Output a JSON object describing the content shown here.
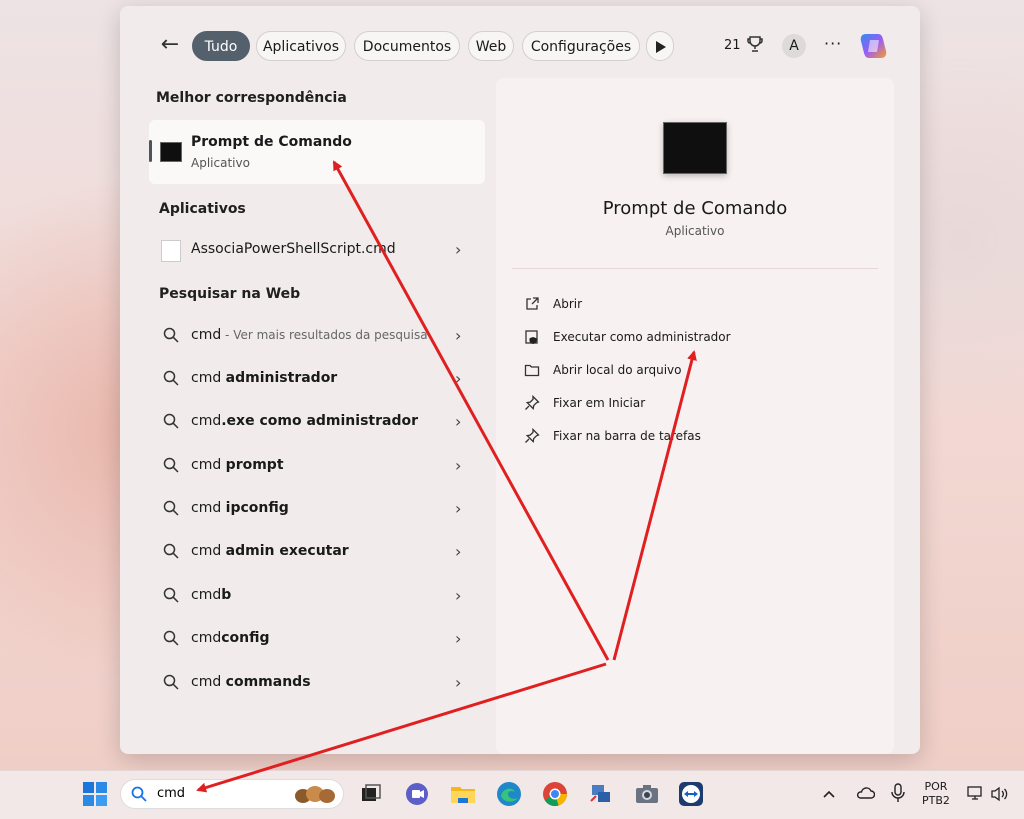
{
  "search_panel": {
    "tabs": [
      "Tudo",
      "Aplicativos",
      "Documentos",
      "Web",
      "Configurações"
    ],
    "active_tab": "Tudo",
    "points": "21",
    "avatar_initial": "A",
    "more_label": "···"
  },
  "best_match": {
    "heading": "Melhor correspondência",
    "name": "Prompt de Comando",
    "type": "Aplicativo"
  },
  "apps": {
    "heading": "Aplicativos",
    "items": [
      {
        "name": "AssociaPowerShellScript.cmd"
      }
    ]
  },
  "web": {
    "heading": "Pesquisar na Web",
    "first": {
      "query": "cmd",
      "hint": " - Ver mais resultados da pesquisa"
    },
    "suggestions": [
      {
        "prefix": "cmd ",
        "bold": "administrador"
      },
      {
        "prefix": "cmd",
        "bold": ".exe como administrador"
      },
      {
        "prefix": "cmd ",
        "bold": "prompt"
      },
      {
        "prefix": "cmd ",
        "bold": "ipconfig"
      },
      {
        "prefix": "cmd ",
        "bold": "admin executar"
      },
      {
        "prefix": "cmd",
        "bold": "b"
      },
      {
        "prefix": "cmd",
        "bold": "config"
      },
      {
        "prefix": "cmd ",
        "bold": "commands"
      }
    ]
  },
  "details": {
    "title": "Prompt de Comando",
    "subtitle": "Aplicativo",
    "actions": [
      {
        "label": "Abrir",
        "icon": "open-external-icon"
      },
      {
        "label": "Executar como administrador",
        "icon": "shield-icon"
      },
      {
        "label": "Abrir local do arquivo",
        "icon": "folder-icon"
      },
      {
        "label": "Fixar em Iniciar",
        "icon": "pin-icon"
      },
      {
        "label": "Fixar na barra de tarefas",
        "icon": "pin-icon"
      }
    ]
  },
  "taskbar": {
    "search_value": "cmd",
    "lang_line1": "POR",
    "lang_line2": "PTB2"
  },
  "colors": {
    "annotation_arrow": "#e02020",
    "active_chip": "#54606b",
    "accent_blue": "#1a73e8"
  }
}
